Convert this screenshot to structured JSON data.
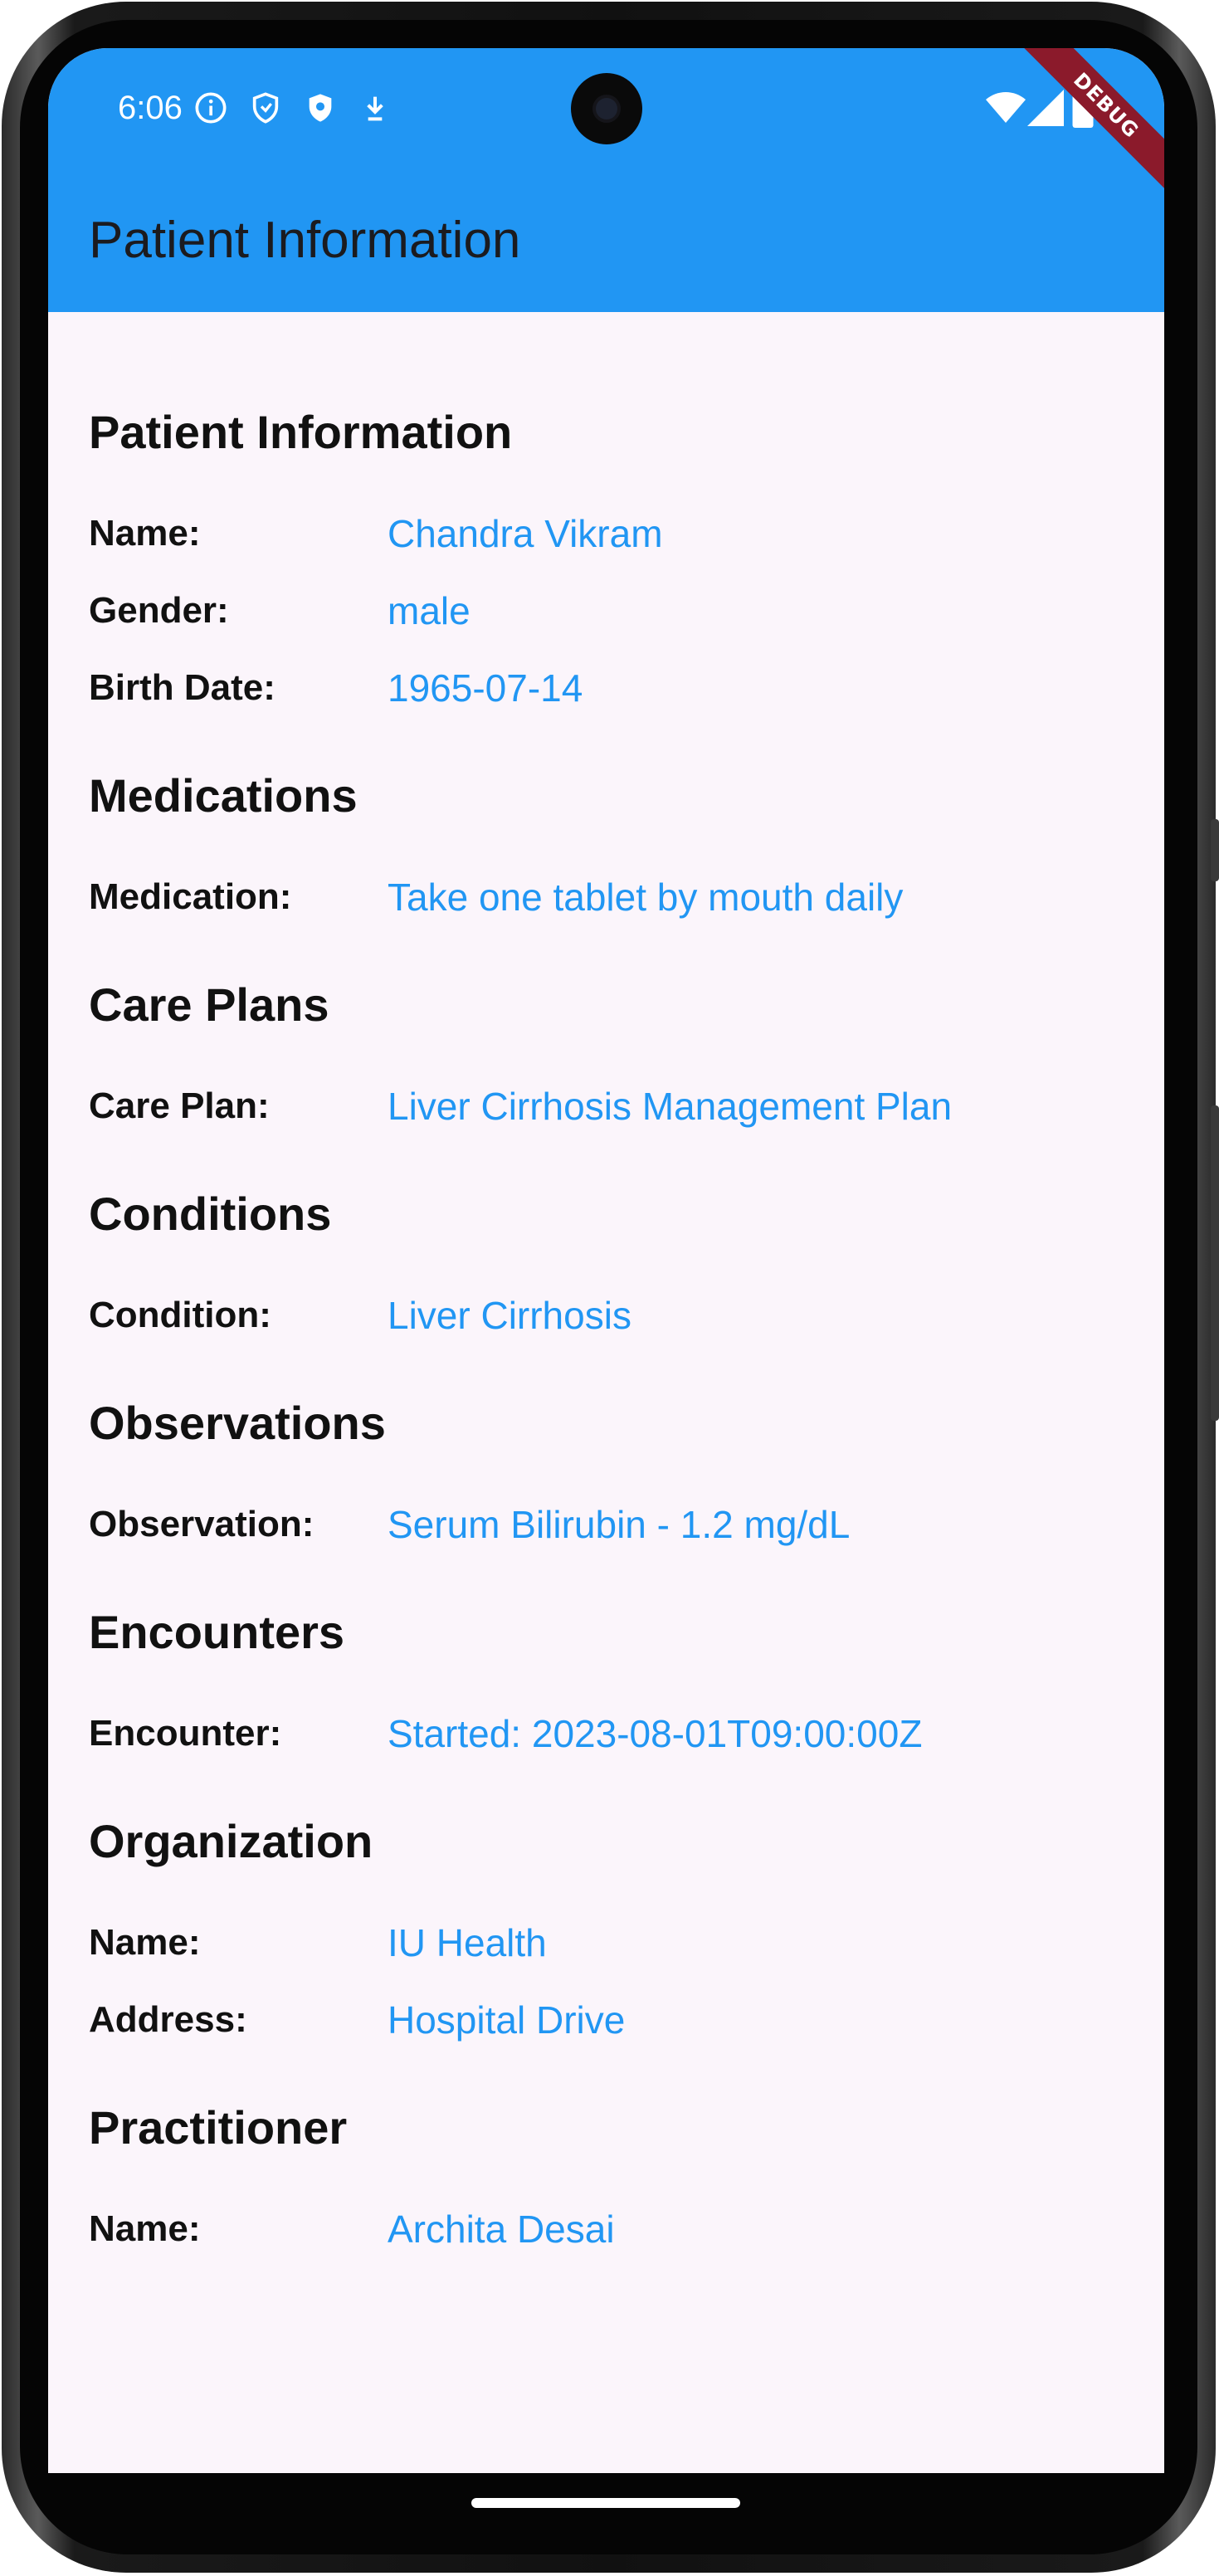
{
  "status_bar": {
    "time": "6:06",
    "icons": [
      "info-icon",
      "shield-outline-icon",
      "shield-filled-icon",
      "download-icon",
      "wifi-icon",
      "signal-icon",
      "battery-icon"
    ]
  },
  "debug_banner": "DEBUG",
  "app_bar": {
    "title": "Patient Information"
  },
  "colors": {
    "app_bar": "#2196f3",
    "value_text": "#2196f3",
    "background": "#fbf5fb",
    "debug_banner": "#8b1a2b"
  },
  "sections": {
    "patient": {
      "title": "Patient Information",
      "name_label": "Name:",
      "name_value": "Chandra Vikram",
      "gender_label": "Gender:",
      "gender_value": "male",
      "birth_label": "Birth Date:",
      "birth_value": "1965-07-14"
    },
    "medications": {
      "title": "Medications",
      "label": "Medication:",
      "value": "Take one tablet by mouth daily"
    },
    "care_plans": {
      "title": "Care Plans",
      "label": "Care Plan:",
      "value": "Liver Cirrhosis Management Plan"
    },
    "conditions": {
      "title": "Conditions",
      "label": "Condition:",
      "value": "Liver Cirrhosis"
    },
    "observations": {
      "title": "Observations",
      "label": "Observation:",
      "value": "Serum Bilirubin - 1.2 mg/dL"
    },
    "encounters": {
      "title": "Encounters",
      "label": "Encounter:",
      "value": "Started: 2023-08-01T09:00:00Z"
    },
    "organization": {
      "title": "Organization",
      "name_label": "Name:",
      "name_value": "IU Health",
      "address_label": "Address:",
      "address_value": "Hospital Drive"
    },
    "practitioner": {
      "title": "Practitioner",
      "name_label": "Name:",
      "name_value": "Archita Desai"
    }
  }
}
